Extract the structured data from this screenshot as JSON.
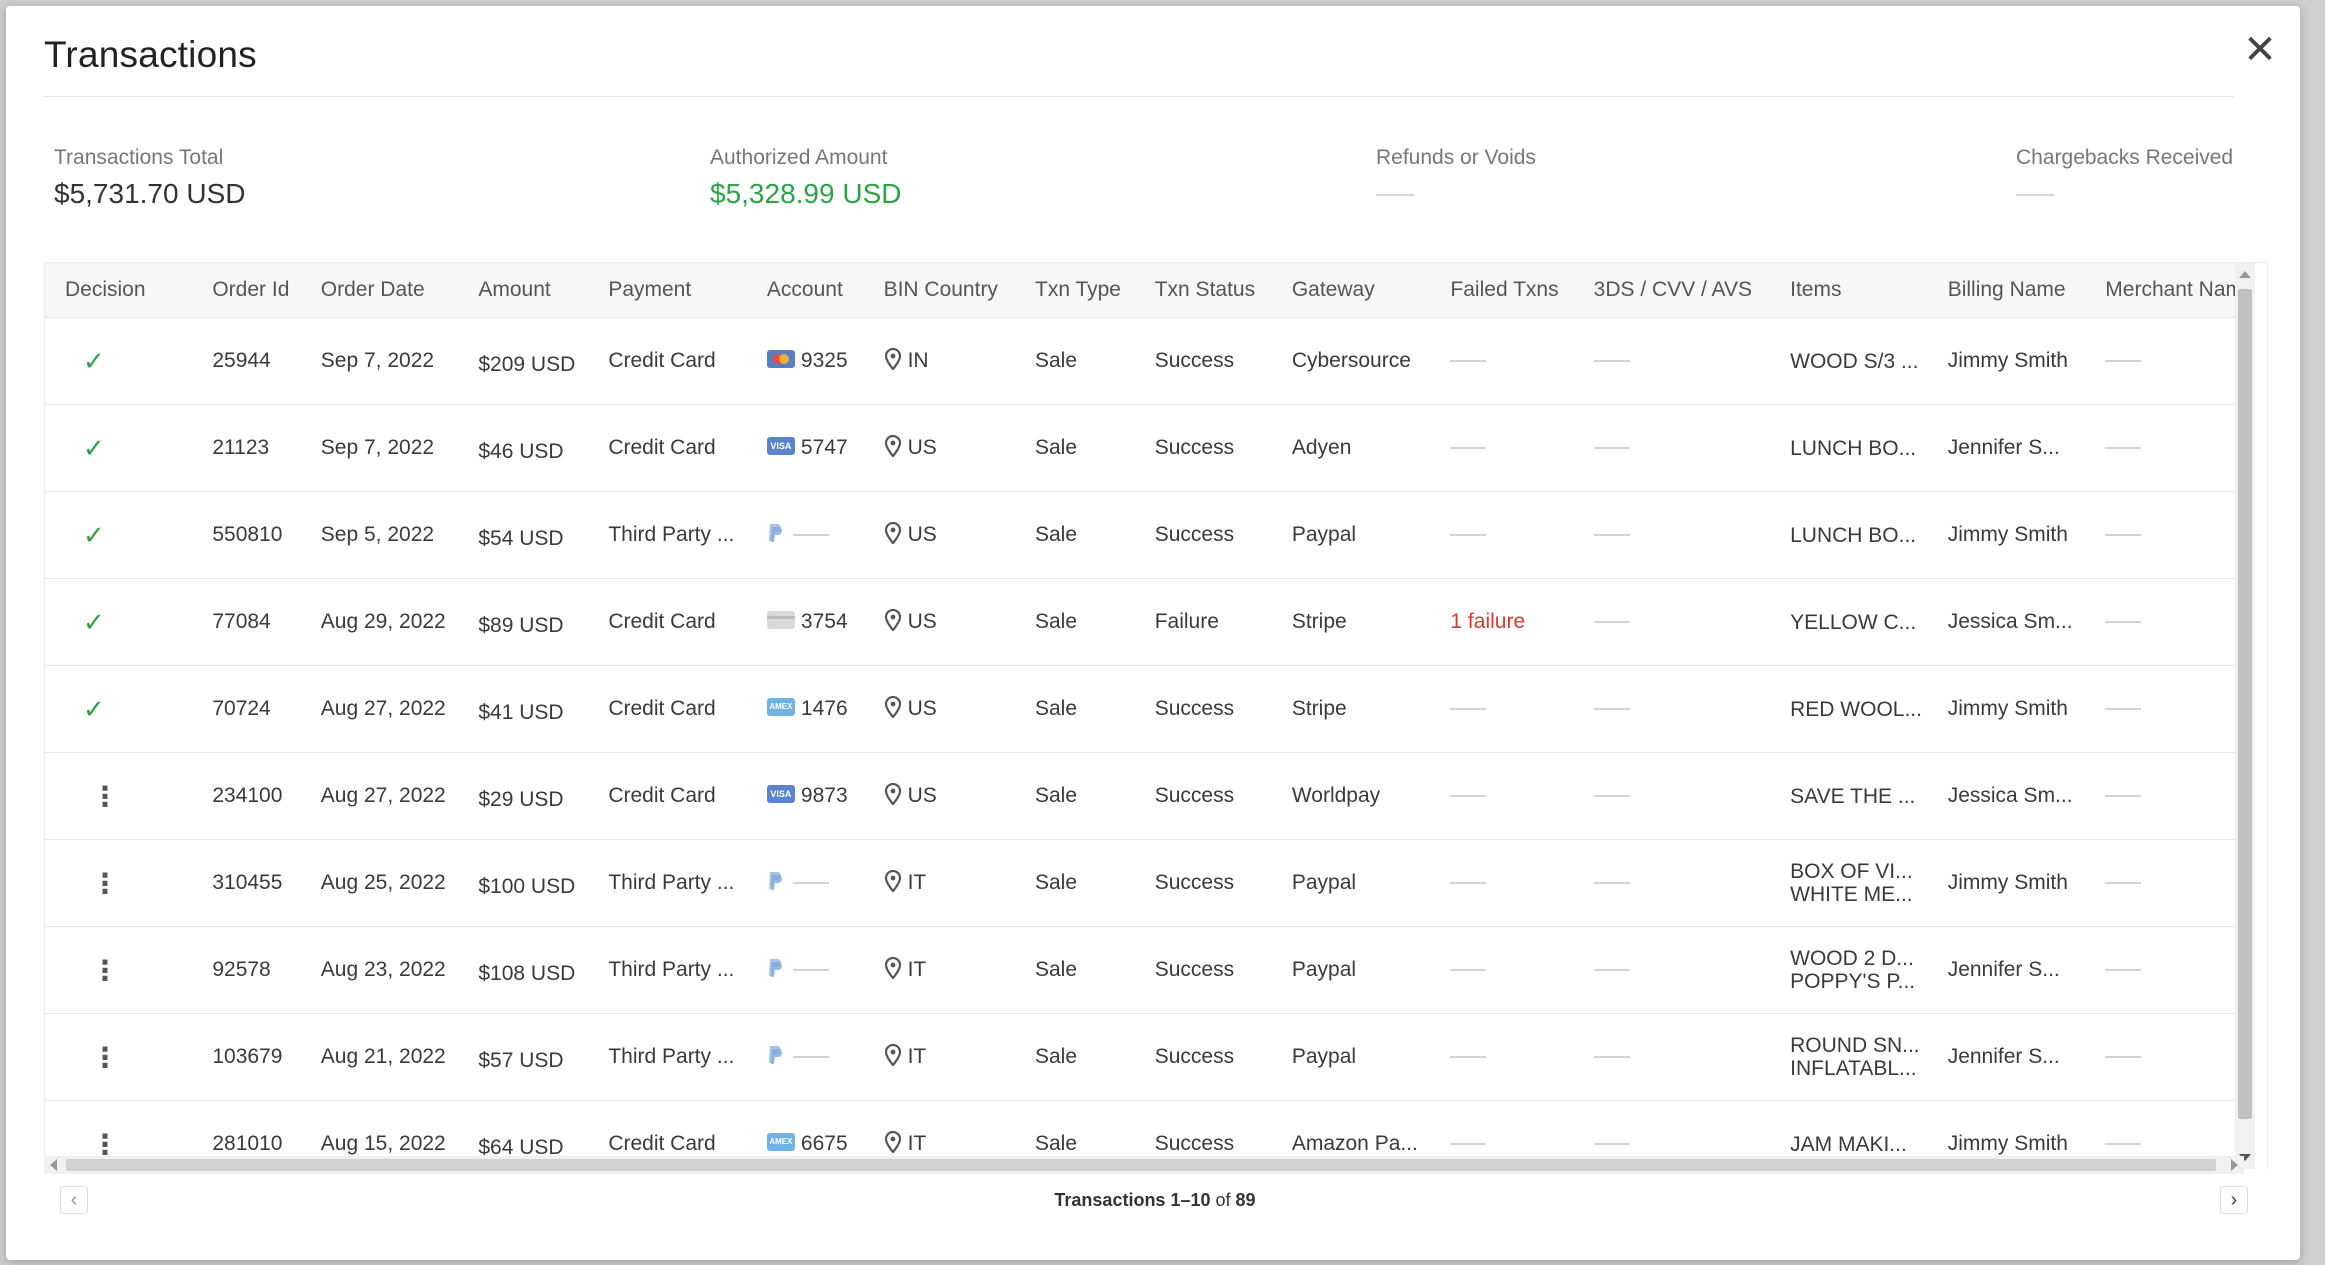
{
  "modal": {
    "title": "Transactions",
    "close_glyph": "✕"
  },
  "summary": [
    {
      "label": "Transactions Total",
      "value": "$5,731.70 USD",
      "style": "normal"
    },
    {
      "label": "Authorized Amount",
      "value": "$5,328.99 USD",
      "style": "green"
    },
    {
      "label": "Refunds or Voids",
      "value": "",
      "style": "dash"
    },
    {
      "label": "Chargebacks Received",
      "value": "",
      "style": "dash"
    }
  ],
  "colors": {
    "accent_green": "#2aa545",
    "failure_red": "#e0362c"
  },
  "table": {
    "columns": [
      "Decision",
      "Order Id",
      "Order Date",
      "Amount",
      "Payment",
      "Account",
      "BIN Country",
      "Txn Type",
      "Txn Status",
      "Gateway",
      "Failed Txns",
      "3DS / CVV / AVS",
      "Items",
      "Billing Name",
      "Merchant Name"
    ],
    "rows": [
      {
        "decision": "check",
        "order_id": "25944",
        "order_date": "Sep 7, 2022",
        "amount": "$209 USD",
        "payment": "Credit Card",
        "card": "mc",
        "card_label": "",
        "account": "9325",
        "country": "IN",
        "txn_type": "Sale",
        "txn_status": "Success",
        "gateway": "Cybersource",
        "failed": "",
        "items": [
          "WOOD S/3 ..."
        ],
        "billing_name": "Jimmy Smith"
      },
      {
        "decision": "check",
        "order_id": "21123",
        "order_date": "Sep 7, 2022",
        "amount": "$46 USD",
        "payment": "Credit Card",
        "card": "visa",
        "card_label": "VISA",
        "account": "5747",
        "country": "US",
        "txn_type": "Sale",
        "txn_status": "Success",
        "gateway": "Adyen",
        "failed": "",
        "items": [
          "LUNCH BO..."
        ],
        "billing_name": "Jennifer S..."
      },
      {
        "decision": "check",
        "order_id": "550810",
        "order_date": "Sep 5, 2022",
        "amount": "$54 USD",
        "payment": "Third Party ...",
        "card": "paypal",
        "card_label": "",
        "account": "",
        "country": "US",
        "txn_type": "Sale",
        "txn_status": "Success",
        "gateway": "Paypal",
        "failed": "",
        "items": [
          "LUNCH BO..."
        ],
        "billing_name": "Jimmy Smith"
      },
      {
        "decision": "check",
        "order_id": "77084",
        "order_date": "Aug 29, 2022",
        "amount": "$89 USD",
        "payment": "Credit Card",
        "card": "generic",
        "card_label": "",
        "account": "3754",
        "country": "US",
        "txn_type": "Sale",
        "txn_status": "Failure",
        "gateway": "Stripe",
        "failed": "1 failure",
        "items": [
          "YELLOW C..."
        ],
        "billing_name": "Jessica Sm..."
      },
      {
        "decision": "check",
        "order_id": "70724",
        "order_date": "Aug 27, 2022",
        "amount": "$41 USD",
        "payment": "Credit Card",
        "card": "amex",
        "card_label": "AMEX",
        "account": "1476",
        "country": "US",
        "txn_type": "Sale",
        "txn_status": "Success",
        "gateway": "Stripe",
        "failed": "",
        "items": [
          "RED WOOL..."
        ],
        "billing_name": "Jimmy Smith"
      },
      {
        "decision": "more",
        "order_id": "234100",
        "order_date": "Aug 27, 2022",
        "amount": "$29 USD",
        "payment": "Credit Card",
        "card": "visa",
        "card_label": "VISA",
        "account": "9873",
        "country": "US",
        "txn_type": "Sale",
        "txn_status": "Success",
        "gateway": "Worldpay",
        "failed": "",
        "items": [
          "SAVE THE ..."
        ],
        "billing_name": "Jessica Sm..."
      },
      {
        "decision": "more",
        "order_id": "310455",
        "order_date": "Aug 25, 2022",
        "amount": "$100 USD",
        "payment": "Third Party ...",
        "card": "paypal",
        "card_label": "",
        "account": "",
        "country": "IT",
        "txn_type": "Sale",
        "txn_status": "Success",
        "gateway": "Paypal",
        "failed": "",
        "items": [
          "BOX OF VI...",
          "WHITE ME..."
        ],
        "billing_name": "Jimmy Smith"
      },
      {
        "decision": "more",
        "order_id": "92578",
        "order_date": "Aug 23, 2022",
        "amount": "$108 USD",
        "payment": "Third Party ...",
        "card": "paypal",
        "card_label": "",
        "account": "",
        "country": "IT",
        "txn_type": "Sale",
        "txn_status": "Success",
        "gateway": "Paypal",
        "failed": "",
        "items": [
          "WOOD 2 D...",
          "POPPY'S P..."
        ],
        "billing_name": "Jennifer S..."
      },
      {
        "decision": "more",
        "order_id": "103679",
        "order_date": "Aug 21, 2022",
        "amount": "$57 USD",
        "payment": "Third Party ...",
        "card": "paypal",
        "card_label": "",
        "account": "",
        "country": "IT",
        "txn_type": "Sale",
        "txn_status": "Success",
        "gateway": "Paypal",
        "failed": "",
        "items": [
          "ROUND SN...",
          "INFLATABL..."
        ],
        "billing_name": "Jennifer S..."
      },
      {
        "decision": "more",
        "order_id": "281010",
        "order_date": "Aug 15, 2022",
        "amount": "$64 USD",
        "payment": "Credit Card",
        "card": "amex",
        "card_label": "AMEX",
        "account": "6675",
        "country": "IT",
        "txn_type": "Sale",
        "txn_status": "Success",
        "gateway": "Amazon Pa...",
        "failed": "",
        "items": [
          "JAM MAKI..."
        ],
        "billing_name": "Jimmy Smith"
      }
    ]
  },
  "pager": {
    "range_label": "Transactions 1–10",
    "of_label": "of",
    "total": "89",
    "prev_glyph": "‹",
    "next_glyph": "›"
  }
}
